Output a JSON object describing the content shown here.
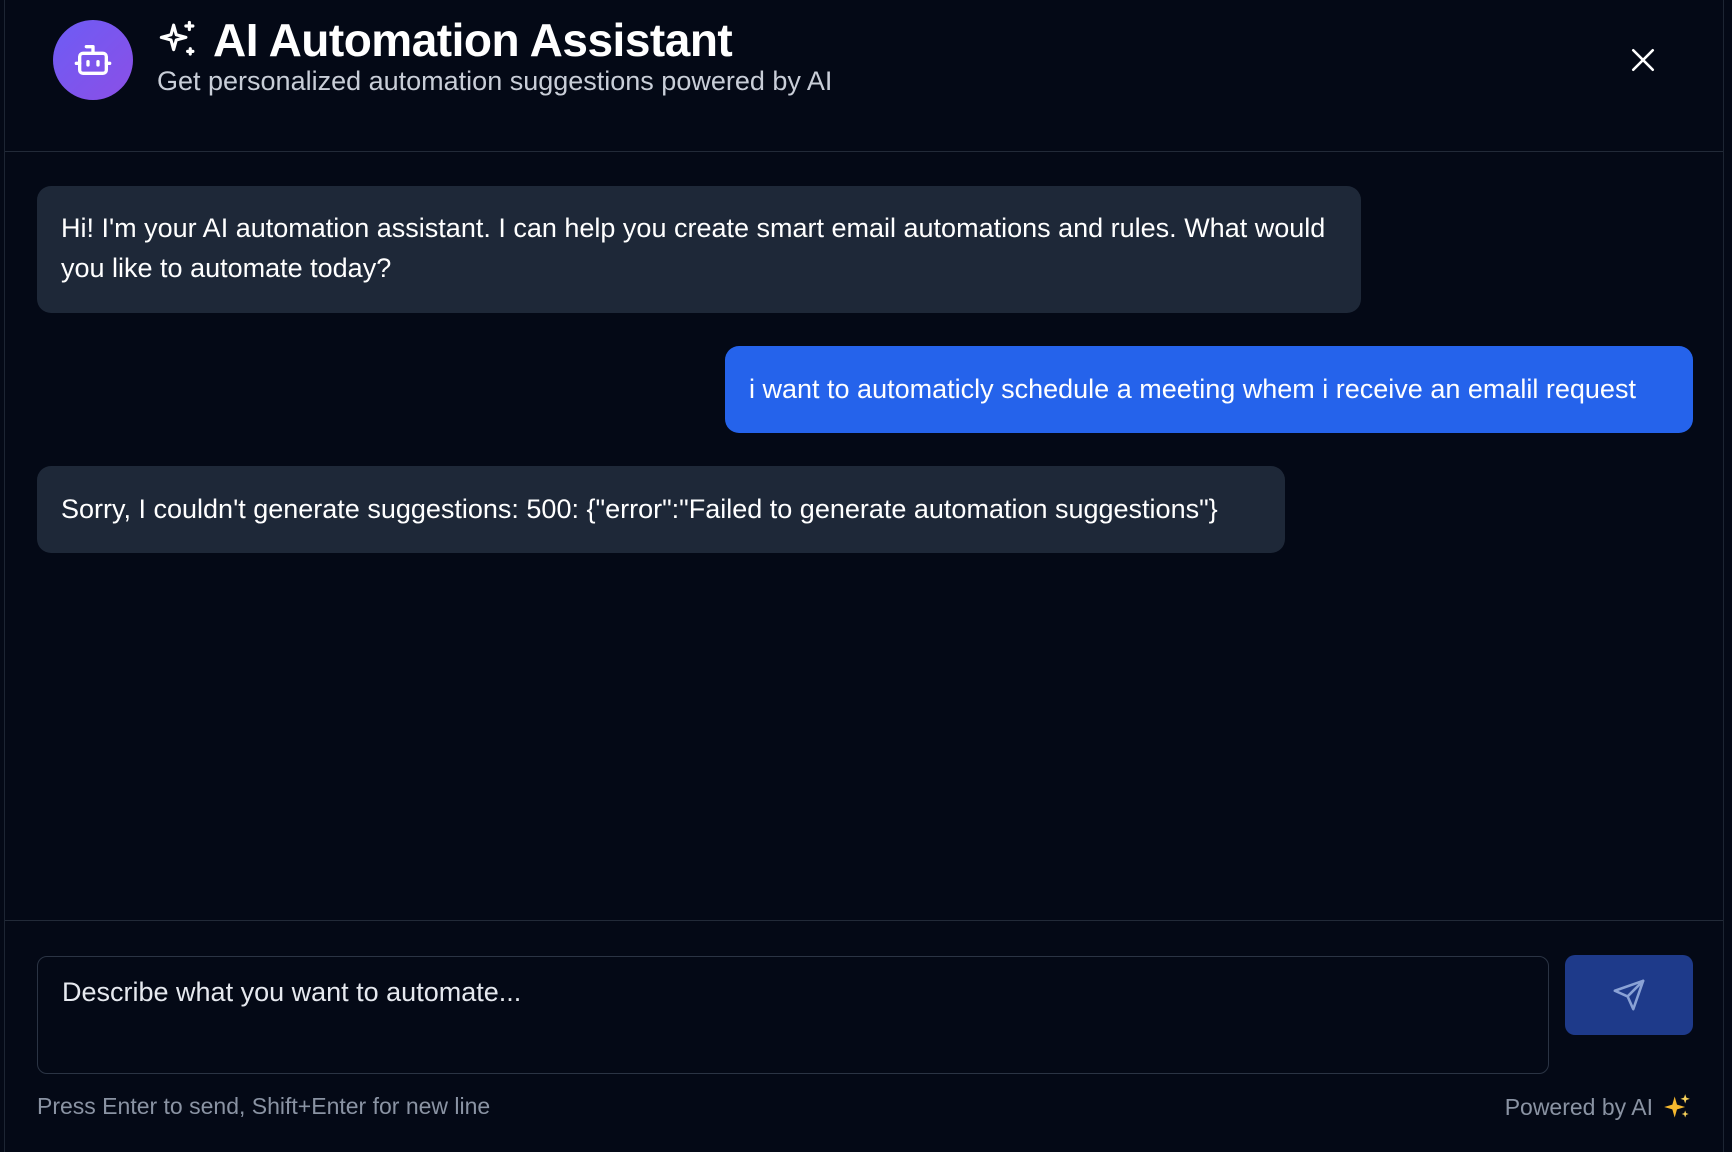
{
  "header": {
    "title": "AI Automation Assistant",
    "subtitle": "Get personalized automation suggestions powered by AI",
    "avatar_icon": "robot-icon",
    "title_icon": "sparkles-icon",
    "close_icon": "close-icon"
  },
  "messages": [
    {
      "role": "assistant",
      "text": "Hi! I'm your AI automation assistant. I can help you create smart email automations and rules. What would you like to automate today?"
    },
    {
      "role": "user",
      "text": "i want to automaticly schedule a meeting whem i receive an emalil request"
    },
    {
      "role": "assistant",
      "text": "Sorry, I couldn't generate suggestions: 500: {\"error\":\"Failed to generate automation suggestions\"}"
    }
  ],
  "composer": {
    "placeholder": "Describe what you want to automate...",
    "value": "",
    "send_icon": "send-icon",
    "hint": "Press Enter to send, Shift+Enter for new line",
    "powered_by": "Powered by AI"
  },
  "colors": {
    "background": "#040916",
    "assistant_bubble": "#1e2838",
    "user_bubble": "#2563eb",
    "send_button": "#1e3a8a",
    "avatar_gradient_start": "#6d5cf5",
    "avatar_gradient_end": "#8b4fe6"
  }
}
